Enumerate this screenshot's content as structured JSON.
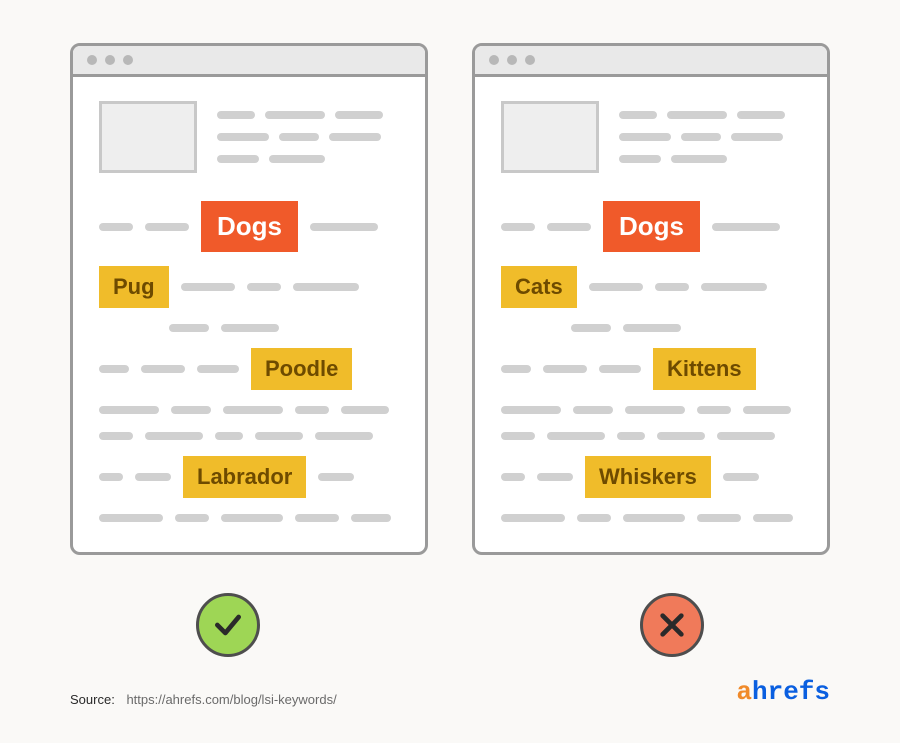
{
  "panels": {
    "good": {
      "primary_tag": "Dogs",
      "tags": [
        "Pug",
        "Poodle",
        "Labrador"
      ],
      "status": "correct"
    },
    "bad": {
      "primary_tag": "Dogs",
      "tags": [
        "Cats",
        "Kittens",
        "Whiskers"
      ],
      "status": "incorrect"
    }
  },
  "source": {
    "label": "Source:",
    "url": "https://ahrefs.com/blog/lsi-keywords/"
  },
  "brand": {
    "first": "a",
    "rest": "hrefs"
  }
}
